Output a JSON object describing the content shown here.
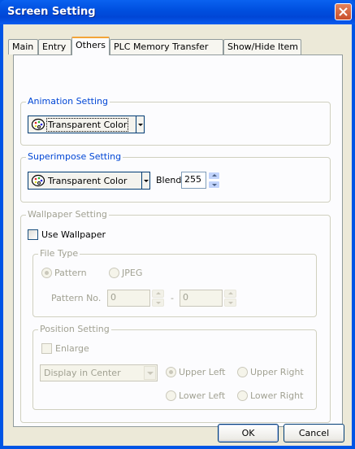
{
  "window": {
    "title": "Screen Setting"
  },
  "tabs": [
    {
      "label": "Main"
    },
    {
      "label": "Entry"
    },
    {
      "label": "Others"
    },
    {
      "label": "PLC Memory Transfer"
    },
    {
      "label": "Show/Hide Item"
    }
  ],
  "active_tab": "Others",
  "animation": {
    "group_label": "Animation Setting",
    "color_value": "Transparent Color"
  },
  "superimpose": {
    "group_label": "Superimpose Setting",
    "color_value": "Transparent Color",
    "blend_label": "Blend",
    "blend_value": "255"
  },
  "wallpaper": {
    "group_label": "Wallpaper Setting",
    "use_wallpaper_label": "Use Wallpaper",
    "use_wallpaper_checked": false,
    "file_type": {
      "group_label": "File Type",
      "pattern_label": "Pattern",
      "jpeg_label": "JPEG",
      "selected": "Pattern",
      "pattern_no_label": "Pattern No.",
      "pattern_from": "0",
      "separator": "-",
      "pattern_to": "0"
    },
    "position": {
      "group_label": "Position Setting",
      "enlarge_label": "Enlarge",
      "enlarge_checked": false,
      "display_value": "Display in Center",
      "upper_left": "Upper Left",
      "upper_right": "Upper Right",
      "lower_left": "Lower Left",
      "lower_right": "Lower Right",
      "selected": "Upper Left"
    }
  },
  "buttons": {
    "ok": "OK",
    "cancel": "Cancel"
  },
  "colors": {
    "titlebar": "#0055e5",
    "group_label": "#0046d5",
    "disabled_text": "#a1a192",
    "dialog_bg": "#ece9d8",
    "active_tab_accent": "#f3a538"
  },
  "icons": [
    "close-icon",
    "palette-icon",
    "chevron-down-icon",
    "spin-up-icon",
    "spin-down-icon"
  ]
}
